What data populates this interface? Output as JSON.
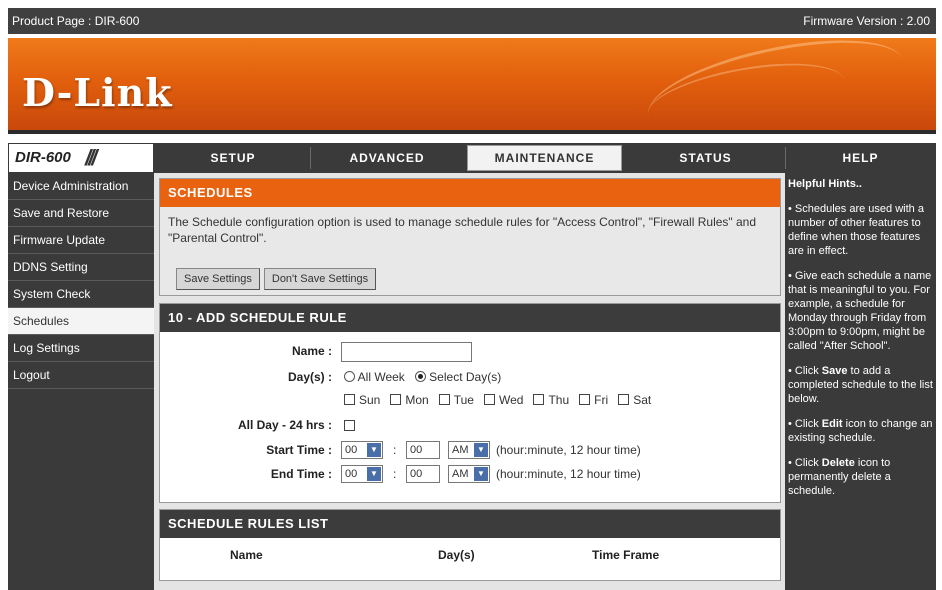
{
  "header": {
    "product_label": "Product Page : DIR-600",
    "firmware_label": "Firmware Version : 2.00",
    "logo_text": "D-Link",
    "model": "DIR-600"
  },
  "nav": {
    "tabs": [
      {
        "label": "SETUP"
      },
      {
        "label": "ADVANCED"
      },
      {
        "label": "MAINTENANCE"
      },
      {
        "label": "STATUS"
      },
      {
        "label": "HELP"
      }
    ],
    "active": "MAINTENANCE"
  },
  "sidebar": {
    "items": [
      {
        "label": "Device Administration"
      },
      {
        "label": "Save and Restore"
      },
      {
        "label": "Firmware Update"
      },
      {
        "label": "DDNS Setting"
      },
      {
        "label": "System Check"
      },
      {
        "label": "Schedules"
      },
      {
        "label": "Log Settings"
      },
      {
        "label": "Logout"
      }
    ],
    "active": "Schedules"
  },
  "schedules": {
    "heading": "SCHEDULES",
    "description": "The Schedule configuration option is used to manage schedule rules for \"Access Control\", \"Firewall Rules\" and \"Parental Control\".",
    "save_label": "Save Settings",
    "dont_save_label": "Don't Save Settings"
  },
  "add_rule": {
    "heading": "10 - ADD SCHEDULE RULE",
    "name_label": "Name :",
    "name_value": "",
    "days_label": "Day(s) :",
    "all_week_label": "All Week",
    "select_days_label": "Select Day(s)",
    "days_mode": "Select Day(s)",
    "days": [
      "Sun",
      "Mon",
      "Tue",
      "Wed",
      "Thu",
      "Fri",
      "Sat"
    ],
    "all_day_label": "All Day - 24 hrs :",
    "start_label": "Start Time :",
    "end_label": "End Time :",
    "hour_value": "00",
    "minute_value": "00",
    "ampm_value": "AM",
    "colon": ":",
    "time_hint": "(hour:minute, 12 hour time)"
  },
  "rules_list": {
    "heading": "SCHEDULE RULES LIST",
    "columns": [
      "Name",
      "Day(s)",
      "Time Frame"
    ]
  },
  "help": {
    "title": "Helpful Hints..",
    "hint1": "• Schedules are used with a number of other features to define when those features are in effect.",
    "hint2": "• Give each schedule a name that is meaningful to you. For example, a schedule for Monday through Friday from 3:00pm to 9:00pm, might be called \"After School\".",
    "hint3_pre": "• Click ",
    "hint3_bold": "Save",
    "hint3_post": " to add a completed schedule to the list below.",
    "hint4_pre": "• Click ",
    "hint4_bold": "Edit",
    "hint4_post": " icon to change an existing schedule.",
    "hint5_pre": "• Click ",
    "hint5_bold": "Delete",
    "hint5_post": " icon to permanently delete a schedule."
  },
  "colors": {
    "orange": "#e8620f",
    "dark": "#3a3a3a",
    "panel": "#e4e4e4"
  }
}
